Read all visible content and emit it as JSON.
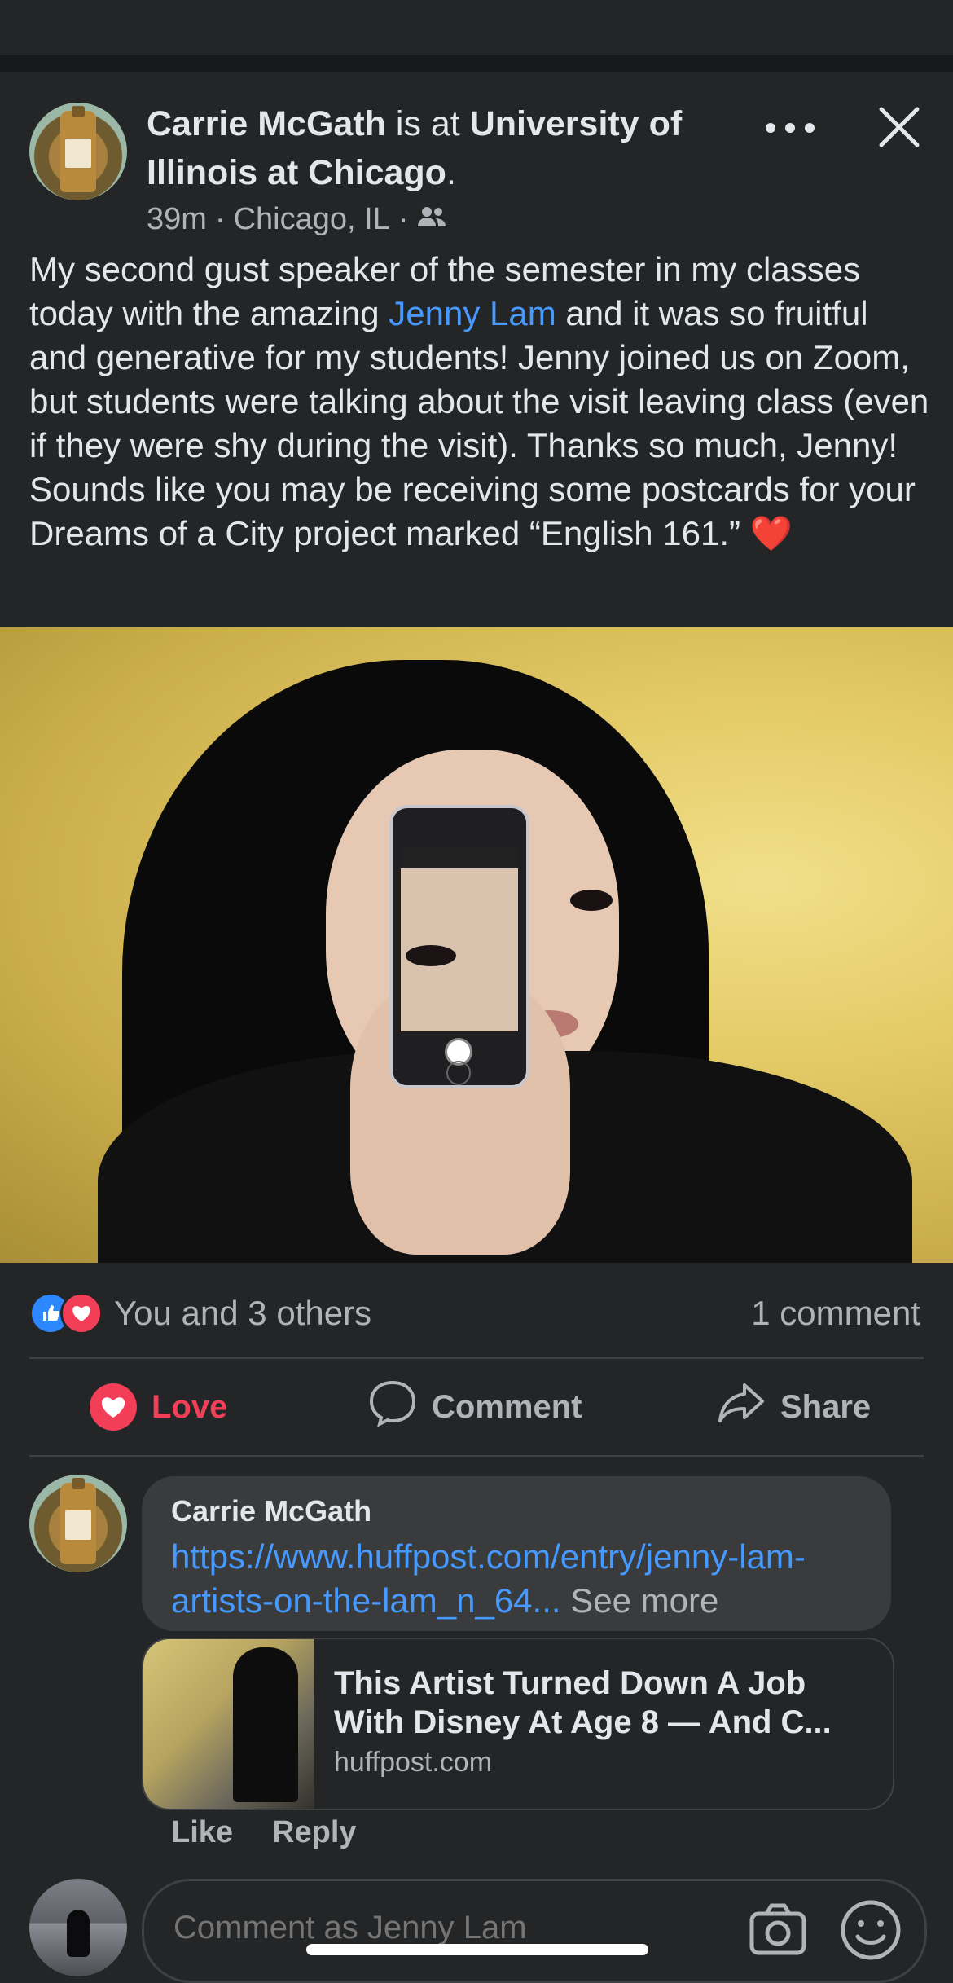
{
  "post": {
    "author": "Carrie McGath",
    "is_at": " is at ",
    "location_name": "University of Illinois at Chicago",
    "period": ".",
    "time": "39m",
    "sep1": " · ",
    "city": "Chicago, IL",
    "sep2": " · ",
    "audience_icon": "friends-icon",
    "body_part1": "My second gust speaker of the semester in my classes today with the amazing ",
    "body_mention": "Jenny Lam",
    "body_part2": " and it was so fruitful and generative for my students! Jenny joined us on Zoom, but students were talking about the visit leaving class (even if they were shy during the visit). Thanks so much, Jenny! Sounds like you may be receiving some postcards for your Dreams of a City project marked “English 161.” ",
    "body_emoji": "❤️",
    "more_icon": "more-icon",
    "close_icon": "close-icon"
  },
  "reactions": {
    "summary": "You and 3 others",
    "comments_count": "1 comment",
    "like_color": "#2d88ff",
    "love_color": "#f33e58"
  },
  "actions": {
    "love_label": "Love",
    "comment_label": "Comment",
    "share_label": "Share"
  },
  "comment": {
    "author": "Carrie McGath",
    "link_text": "https://www.huffpost.com/entry/jenny-lam-artists-on-the-lam_n_64...",
    "see_more": " See more",
    "card_title": "This Artist Turned Down A Job With Disney At Age 8 — And C...",
    "card_domain": "huffpost.com",
    "like_label": "Like",
    "reply_label": "Reply"
  },
  "composer": {
    "placeholder": "Comment as Jenny Lam",
    "camera_icon": "camera-icon",
    "emoji_icon": "smiley-icon"
  },
  "colors": {
    "background": "#242526",
    "link": "#4599ff",
    "secondary_text": "#b0b3b8",
    "primary_text": "#e4e6eb"
  }
}
